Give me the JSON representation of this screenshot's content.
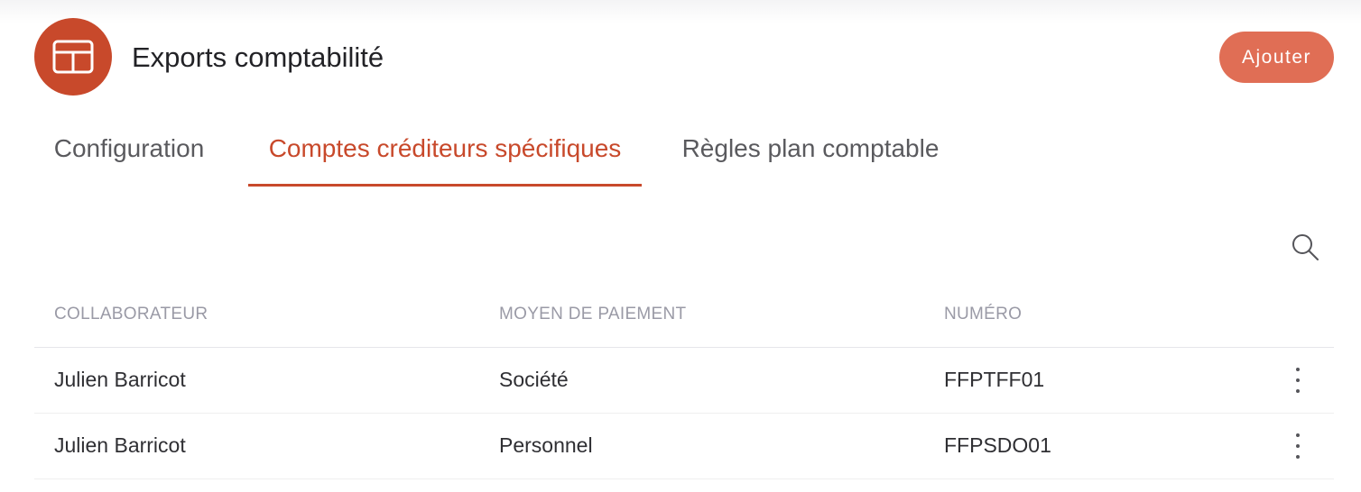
{
  "header": {
    "title": "Exports comptabilité",
    "icon": "layout-panel-icon",
    "icon_bg": "#c8492b",
    "add_label": "Ajouter",
    "add_bg": "#e06e55"
  },
  "tabs": [
    {
      "label": "Configuration",
      "active": false
    },
    {
      "label": "Comptes créditeurs spécifiques",
      "active": true
    },
    {
      "label": "Règles plan comptable",
      "active": false
    }
  ],
  "accent": "#c8492b",
  "toolbar": {
    "search_icon": "search-icon"
  },
  "table": {
    "headers": [
      "COLLABORATEUR",
      "MOYEN DE PAIEMENT",
      "NUMÉRO"
    ],
    "rows": [
      {
        "collaborateur": "Julien Barricot",
        "moyen": "Société",
        "numero": "FFPTFF01",
        "menu_icon": "more-vertical-icon"
      },
      {
        "collaborateur": "Julien Barricot",
        "moyen": "Personnel",
        "numero": "FFPSDO01",
        "menu_icon": "more-vertical-icon"
      }
    ]
  }
}
